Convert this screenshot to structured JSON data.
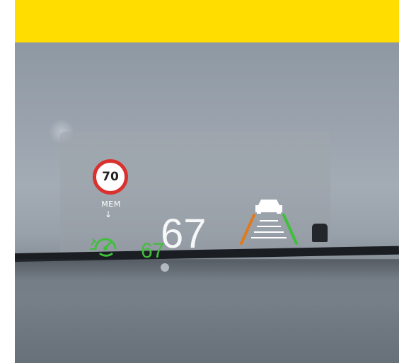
{
  "hud": {
    "speed_limit": "70",
    "mem_label": "MEM",
    "mem_arrow": "↓",
    "current_speed": "67",
    "cruise_speed": "67"
  },
  "icons": {
    "speed_limit": "speed-limit-sign-icon",
    "cruise": "cruise-control-icon",
    "lane_assist": "lane-assist-car-icon"
  },
  "colors": {
    "banner": "#ffdd00",
    "limit_ring": "#d9322e",
    "cruise": "#3fbf3a",
    "lane_left": "#e07a1f",
    "lane_right": "#3fbf3a",
    "hud_text": "#f6f7f9"
  }
}
